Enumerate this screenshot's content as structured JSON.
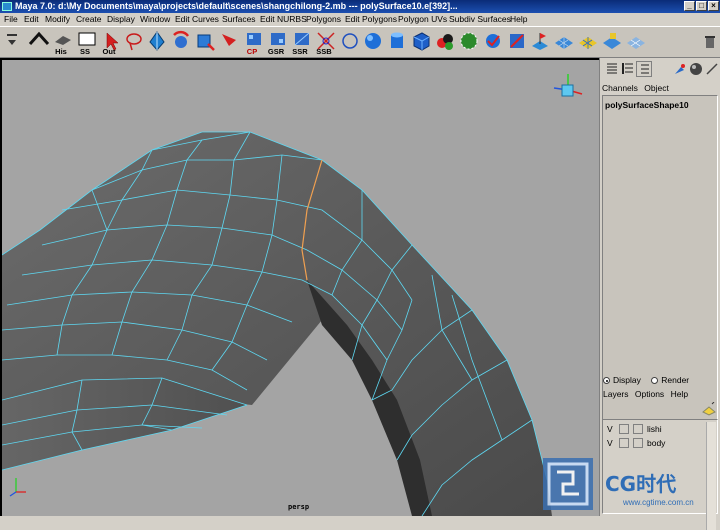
{
  "window": {
    "title": "Maya 7.0: d:\\My Documents\\maya\\projects\\default\\scenes\\shangchilong-2.mb  ---  polySurface10.e[392]...",
    "minimize": "_",
    "maximize": "□",
    "close": "×"
  },
  "menu": [
    "File",
    "Edit",
    "Modify",
    "Create",
    "Display",
    "Window",
    "Edit Curves",
    "Surfaces",
    "Edit NURBS",
    "Polygons",
    "Edit Polygons",
    "Polygon UVs",
    "Subdiv Surfaces",
    "Help"
  ],
  "shelf": {
    "labels": {
      "his": "His",
      "ss": "SS",
      "out": "Out",
      "cp": "CP",
      "gsr": "GSR",
      "ssr": "SSR",
      "ssb": "SSB"
    },
    "icon_names": [
      "shelf-menu-icon",
      "history-icon",
      "ss-icon",
      "out-icon",
      "select-arrow-icon",
      "lasso-icon",
      "move-icon",
      "rotate-icon",
      "scale-icon",
      "cp-icon",
      "gsr-icon",
      "ssr-icon",
      "ssb-icon",
      "split-icon",
      "circle-icon",
      "sphere-icon",
      "cylinder-icon",
      "cube-icon",
      "color-balls-icon",
      "globe-icon",
      "check-icon",
      "plane-icon",
      "flag-icon",
      "grid-icon",
      "grid-blue-icon",
      "grid-check-icon",
      "trash-icon"
    ]
  },
  "viewport": {
    "camera_label": "persp"
  },
  "panel": {
    "channels_tab": "Channels",
    "object_tab": "Object",
    "shape_name": "polySurfaceShape10",
    "display_radio": "Display",
    "render_radio": "Render",
    "layers_menu": "Layers",
    "options_menu": "Options",
    "help_menu": "Help",
    "layers": [
      {
        "visible": "V",
        "name": "lishi"
      },
      {
        "visible": "V",
        "name": "body"
      }
    ]
  },
  "watermark": {
    "brand": "CG时代",
    "url": "www.cgtime.com.cn"
  },
  "colors": {
    "viewport_bg": "#a4a4a4",
    "wire": "#5ed8f2",
    "selected_edge": "#f0a050",
    "title_bar": "#0a2c78"
  }
}
